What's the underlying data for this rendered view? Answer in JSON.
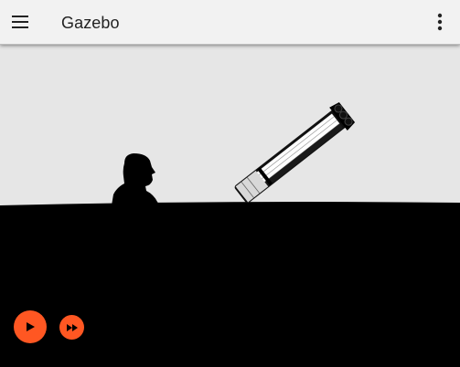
{
  "app_bar": {
    "title": "Gazebo",
    "menu_icon": "hamburger-menu-icon",
    "more_icon": "more-vertical-icon"
  },
  "controls": {
    "play_icon": "play-icon",
    "fast_forward_icon": "fast-forward-icon"
  },
  "colors": {
    "accent": "#ff5722",
    "app_bar_bg": "#f2f2f2",
    "sky": "#e6e6e6",
    "ground": "#000000"
  }
}
